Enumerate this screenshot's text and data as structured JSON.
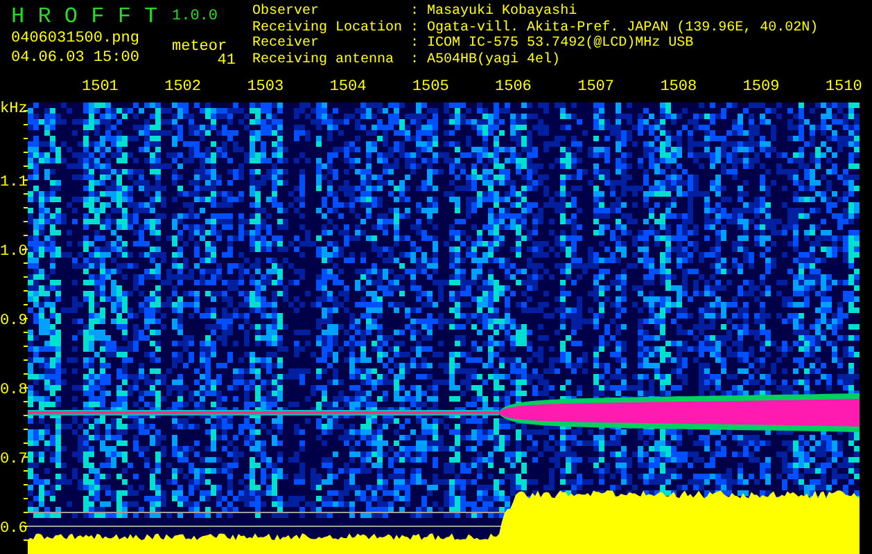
{
  "app": {
    "title": "H R O F F T",
    "version": "1.0.0"
  },
  "file": {
    "name": "0406031500.png",
    "timestamp": "04.06.03 15:00"
  },
  "counter": {
    "label": "meteor",
    "value": "41"
  },
  "station_info": [
    {
      "label": "Observer",
      "separator": ":",
      "value": "Masayuki Kobayashi"
    },
    {
      "label": "Receiving Location",
      "separator": ":",
      "value": "Ogata-vill. Akita-Pref. JAPAN (139.96E, 40.02N)"
    },
    {
      "label": "Receiver",
      "separator": ":",
      "value": "ICOM IC-575 53.7492(@LCD)MHz USB"
    },
    {
      "label": "Receiving antenna",
      "separator": ":",
      "value": "A504HB(yagi 4el)"
    }
  ],
  "spectrogram": {
    "unit": "kHz",
    "time_labels": [
      "1501",
      "1502",
      "1503",
      "1504",
      "1505",
      "1506",
      "1507",
      "1508",
      "1509",
      "1510"
    ],
    "frequency_labels": [
      "1.1",
      "1.0",
      "0.9",
      "0.8",
      "0.7",
      "0.6"
    ]
  }
}
